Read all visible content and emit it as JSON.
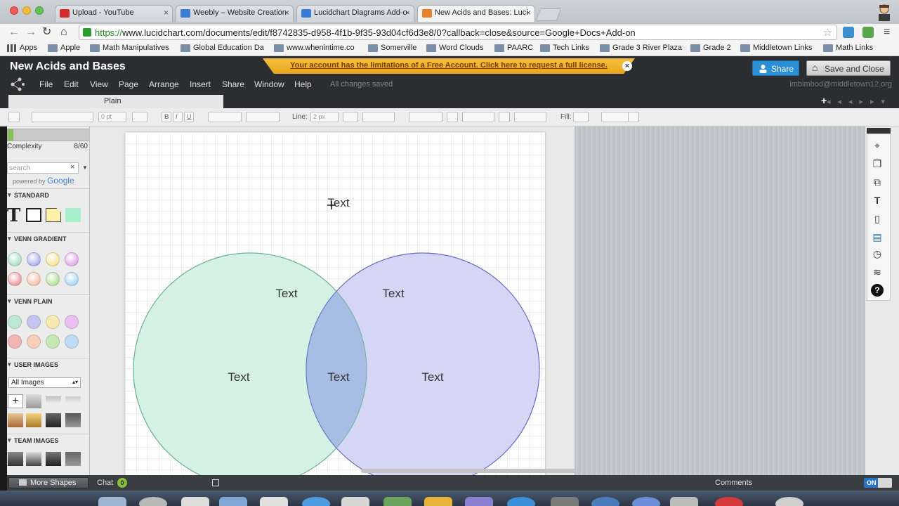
{
  "browser": {
    "tabs": [
      {
        "label": "Upload - YouTube",
        "favicon_color": "#d62b2b"
      },
      {
        "label": "Weebly – Website Creation",
        "favicon_color": "#3a7ad8"
      },
      {
        "label": "Lucidchart Diagrams Add-o",
        "favicon_color": "#3a7ad8"
      },
      {
        "label": "New Acids and Bases: Luci",
        "favicon_color": "#e8822a"
      }
    ],
    "tab_close": "×",
    "url_scheme": "https://",
    "url_rest": "www.lucidchart.com/documents/edit/f8742835-d958-4f1b-9f35-93d04cf6d3e8/0?callback=close&source=Google+Docs+Add-on",
    "back_icon": "←",
    "forward_icon": "→",
    "reload_icon": "↻",
    "home_icon": "⌂",
    "star_icon": "☆",
    "bookmarks": [
      "Apps",
      "Apple",
      "Math Manipulatives",
      "Global Education Da",
      "www.whenintime.co",
      "Somerville",
      "Word Clouds",
      "PAARC",
      "Tech Links",
      "Grade 3 River Plaza",
      "Grade 2",
      "Middletown Links",
      "Math Links"
    ]
  },
  "app": {
    "doc_title": "New Acids and Bases",
    "banner": "Your account has the limitations of a Free Account. Click here to request a full license.",
    "banner_close": "×",
    "share_label": "Share",
    "save_close_label": "Save and Close",
    "menu": [
      "File",
      "Edit",
      "View",
      "Page",
      "Arrange",
      "Insert",
      "Share",
      "Window",
      "Help"
    ],
    "save_status": "All changes saved",
    "user_email": "imbimbod@middletown12.org",
    "page_tab": "Plain",
    "add_page": "+"
  },
  "format_toolbar": {
    "font_size": "0 pt",
    "bold": "B",
    "italic": "I",
    "underline": "U",
    "line_label": "Line:",
    "line_width": "2 px",
    "fill_label": "Fill:"
  },
  "left_panel": {
    "complexity_label": "Complexity",
    "complexity_value": "8/60",
    "search_placeholder": "search",
    "search_clear": "×",
    "powered_by": "powered by",
    "powered_brand": "Google",
    "sections": [
      "STANDARD",
      "VENN GRADIENT",
      "VENN PLAIN",
      "USER IMAGES",
      "TEAM IMAGES"
    ],
    "standard_text_icon": "T",
    "user_images_select": "All Images",
    "colors": {
      "green": "#8fd3b4",
      "blue": "#8c94e6",
      "yellow": "#f2da6e",
      "purple": "#d58be3",
      "red": "#e57a7a",
      "orange": "#f2a98a",
      "lime": "#9ad47a",
      "sky": "#8cc4ef"
    }
  },
  "canvas": {
    "labels": {
      "top": "Text",
      "left_top": "Text",
      "right_top": "Text",
      "left_mid": "Text",
      "center": "Text",
      "right_mid": "Text"
    },
    "left_circle_fill": "#cfeee0",
    "left_circle_stroke": "#6fb596",
    "right_circle_fill": "#cfd0f6",
    "right_circle_stroke": "#6e72c7",
    "overlap_fill": "#a7bde3"
  },
  "right_tools": [
    "⌖",
    "❐",
    "⧉",
    "T",
    "▯",
    "▤",
    "◷",
    "≋",
    "?"
  ],
  "bottom_bar": {
    "more_shapes": "More Shapes",
    "chat": "Chat",
    "chat_badge": "0",
    "comments": "Comments",
    "toggle": "ON"
  }
}
